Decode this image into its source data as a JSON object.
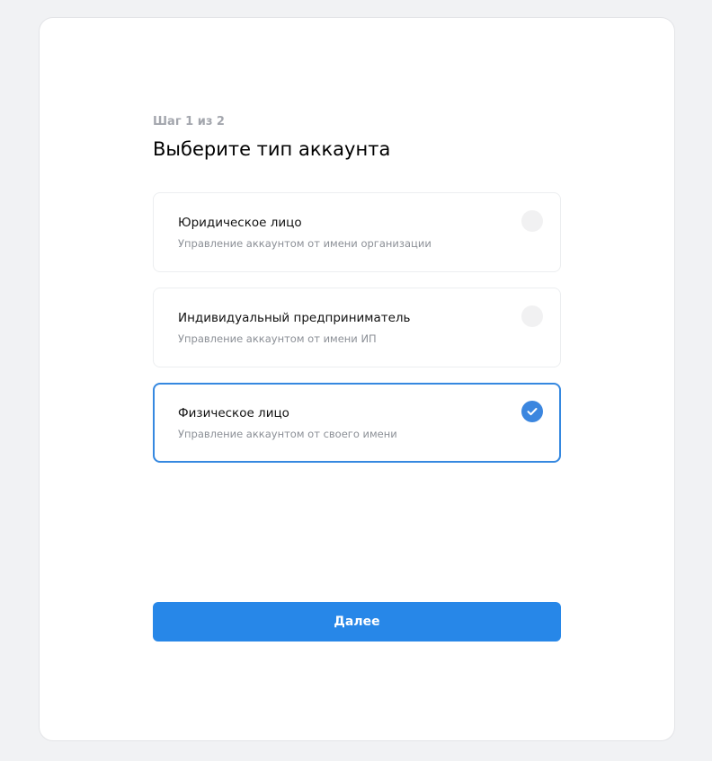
{
  "step": "Шаг 1 из 2",
  "title": "Выберите тип аккаунта",
  "options": [
    {
      "label": "Юридическое лицо",
      "description": "Управление аккаунтом от имени организации",
      "selected": false
    },
    {
      "label": "Индивидуальный предприниматель",
      "description": "Управление аккаунтом от имени ИП",
      "selected": false
    },
    {
      "label": "Физическое лицо",
      "description": "Управление аккаунтом от своего имени",
      "selected": true
    }
  ],
  "next_label": "Далее",
  "colors": {
    "accent": "#2787e8",
    "selected_border": "#3588e0"
  }
}
